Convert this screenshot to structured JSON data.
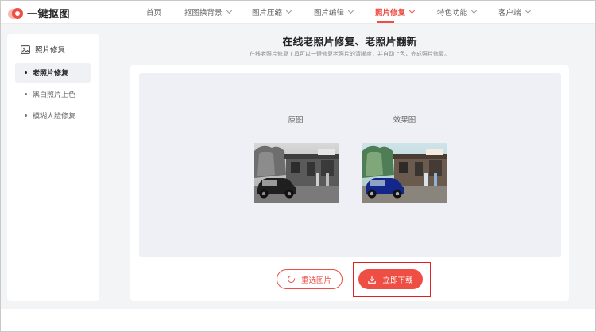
{
  "brand": {
    "name": "一键抠图"
  },
  "nav": {
    "items": [
      {
        "label": "首页",
        "dropdown": false,
        "active": false
      },
      {
        "label": "抠图换背景",
        "dropdown": true,
        "active": false
      },
      {
        "label": "图片压缩",
        "dropdown": true,
        "active": false
      },
      {
        "label": "图片编辑",
        "dropdown": true,
        "active": false
      },
      {
        "label": "照片修复",
        "dropdown": true,
        "active": true
      },
      {
        "label": "特色功能",
        "dropdown": true,
        "active": false
      },
      {
        "label": "客户端",
        "dropdown": true,
        "active": false
      }
    ]
  },
  "sidebar": {
    "title": "照片修复",
    "items": [
      {
        "label": "老照片修复",
        "active": true
      },
      {
        "label": "黑白照片上色",
        "active": false
      },
      {
        "label": "模糊人脸修复",
        "active": false
      }
    ]
  },
  "main": {
    "title": "在线老照片修复、老照片翻新",
    "subtitle": "在线老照片修复工具可以一键修复老照片的清晰度，并自动上色，完成照片修复。",
    "original_label": "原图",
    "result_label": "效果图",
    "reselect_label": "重选图片",
    "download_label": "立即下载"
  },
  "colors": {
    "accent": "#ee4e44",
    "panel": "#eef0f5",
    "highlight": "#e02020"
  }
}
